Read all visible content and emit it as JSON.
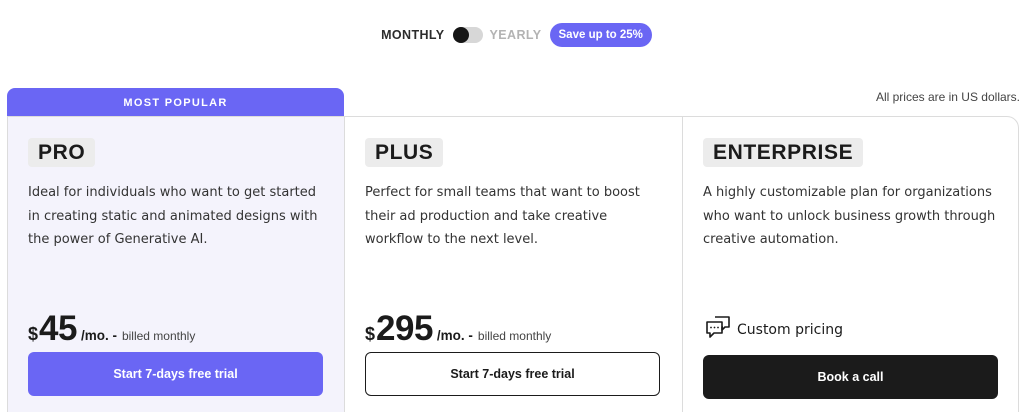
{
  "billing": {
    "monthly_label": "MONTHLY",
    "yearly_label": "YEARLY",
    "selected": "monthly",
    "save_badge": "Save up to 25%"
  },
  "banner": {
    "most_popular": "MOST POPULAR",
    "currency_note": "All prices are in US dollars."
  },
  "plans": [
    {
      "name": "PRO",
      "description": "Ideal for individuals who want to get started in creating static and animated designs with the power of Generative AI.",
      "currency": "$",
      "price": "45",
      "per": "/mo. -",
      "billing_note": "billed monthly",
      "cta": "Start 7-days free trial"
    },
    {
      "name": "PLUS",
      "description": "Perfect for small teams that want to boost their ad production and take creative workflow to the next level.",
      "currency": "$",
      "price": "295",
      "per": "/mo. -",
      "billing_note": "billed monthly",
      "cta": "Start 7-days free trial"
    },
    {
      "name": "ENTERPRISE",
      "description": "A highly customizable plan for organizations who want to unlock business growth through creative automation.",
      "custom_pricing": "Custom pricing",
      "icon": "chat-bubbles-icon",
      "cta": "Book a call"
    }
  ],
  "colors": {
    "accent": "#6a66f4",
    "dark": "#1b1b1b",
    "popular_bg": "#f4f3fc"
  }
}
